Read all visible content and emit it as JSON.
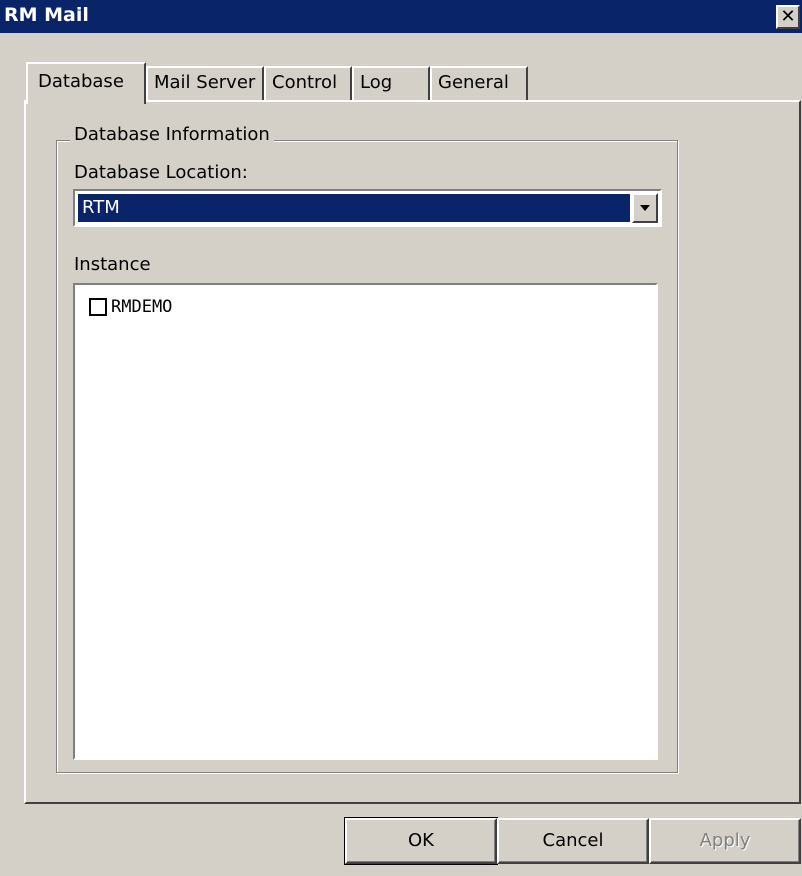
{
  "window": {
    "title": "RM Mail",
    "close_glyph": "✕"
  },
  "tabs": [
    {
      "label": "Database",
      "active": true
    },
    {
      "label": "Mail Server",
      "active": false
    },
    {
      "label": "Control",
      "active": false
    },
    {
      "label": "Log",
      "active": false
    },
    {
      "label": "General",
      "active": false
    }
  ],
  "database": {
    "group_title": "Database Information",
    "location_label": "Database Location:",
    "location_value": "RTM",
    "instance_label": "Instance",
    "instances": [
      {
        "name": "RMDEMO",
        "checked": false
      }
    ]
  },
  "buttons": {
    "ok": "OK",
    "cancel": "Cancel",
    "apply": "Apply"
  },
  "icons": {
    "dropdown": "chevron-down-icon",
    "close": "close-icon"
  },
  "colors": {
    "titlebar": "#0a246a",
    "face": "#d4d0c8",
    "selection": "#0a246a"
  }
}
